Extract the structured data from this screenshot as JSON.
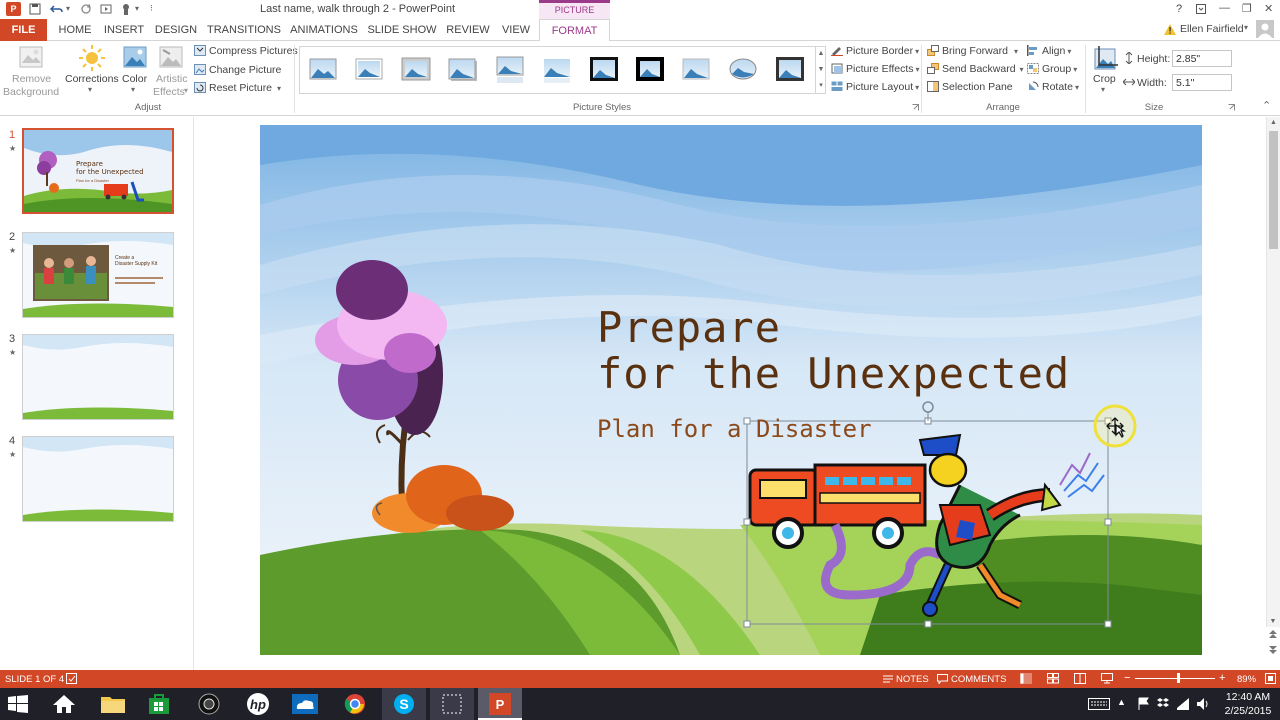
{
  "window": {
    "title": "Last name, walk through 2 - PowerPoint",
    "help_label": "?",
    "minimize_label": "—",
    "restore_label": "❐",
    "close_label": "✕"
  },
  "contextual_tab": {
    "group_label": "PICTURE TOOLS"
  },
  "tabs": {
    "file": "FILE",
    "home": "HOME",
    "insert": "INSERT",
    "design": "DESIGN",
    "transitions": "TRANSITIONS",
    "animations": "ANIMATIONS",
    "slideshow": "SLIDE SHOW",
    "review": "REVIEW",
    "view": "VIEW",
    "format": "FORMAT"
  },
  "user": {
    "name": "Ellen Fairfield"
  },
  "ribbon": {
    "remove_bg_line1": "Remove",
    "remove_bg_line2": "Background",
    "corrections": "Corrections",
    "color": "Color",
    "artistic_line1": "Artistic",
    "artistic_line2": "Effects",
    "compress": "Compress Pictures",
    "change": "Change Picture",
    "reset": "Reset Picture",
    "adjust_label": "Adjust",
    "picture_styles_label": "Picture Styles",
    "picture_border": "Picture Border",
    "picture_effects": "Picture Effects",
    "picture_layout": "Picture Layout",
    "bring_forward": "Bring Forward",
    "send_backward": "Send Backward",
    "selection_pane": "Selection Pane",
    "align": "Align",
    "group": "Group",
    "rotate": "Rotate",
    "arrange_label": "Arrange",
    "crop": "Crop",
    "height_label": "Height:",
    "height_value": "2.85\"",
    "width_label": "Width:",
    "width_value": "5.1\"",
    "size_label": "Size"
  },
  "thumbnails": [
    {
      "num": "1",
      "title_line1": "Prepare",
      "title_line2": "for the Unexpected",
      "subtitle": "Plan for a Disaster"
    },
    {
      "num": "2",
      "title_line1": "Create a",
      "title_line2": "Disaster Supply Kit"
    },
    {
      "num": "3"
    },
    {
      "num": "4"
    }
  ],
  "slide": {
    "title_line1": "Prepare",
    "title_line2": "for the Unexpected",
    "subtitle": "Plan for a Disaster"
  },
  "status": {
    "slide_indicator": "SLIDE 1 OF 4",
    "notes": "NOTES",
    "comments": "COMMENTS",
    "zoom_minus": "−",
    "zoom_plus": "+",
    "zoom": "89%",
    "zoom_level": 0.54
  },
  "clock": {
    "time": "12:40 AM",
    "date": "2/25/2015"
  },
  "colors": {
    "accent": "#d24726",
    "context_tab": "#9c3a8a",
    "title_text": "#5a3110",
    "subtitle_text": "#8a4a1c"
  }
}
